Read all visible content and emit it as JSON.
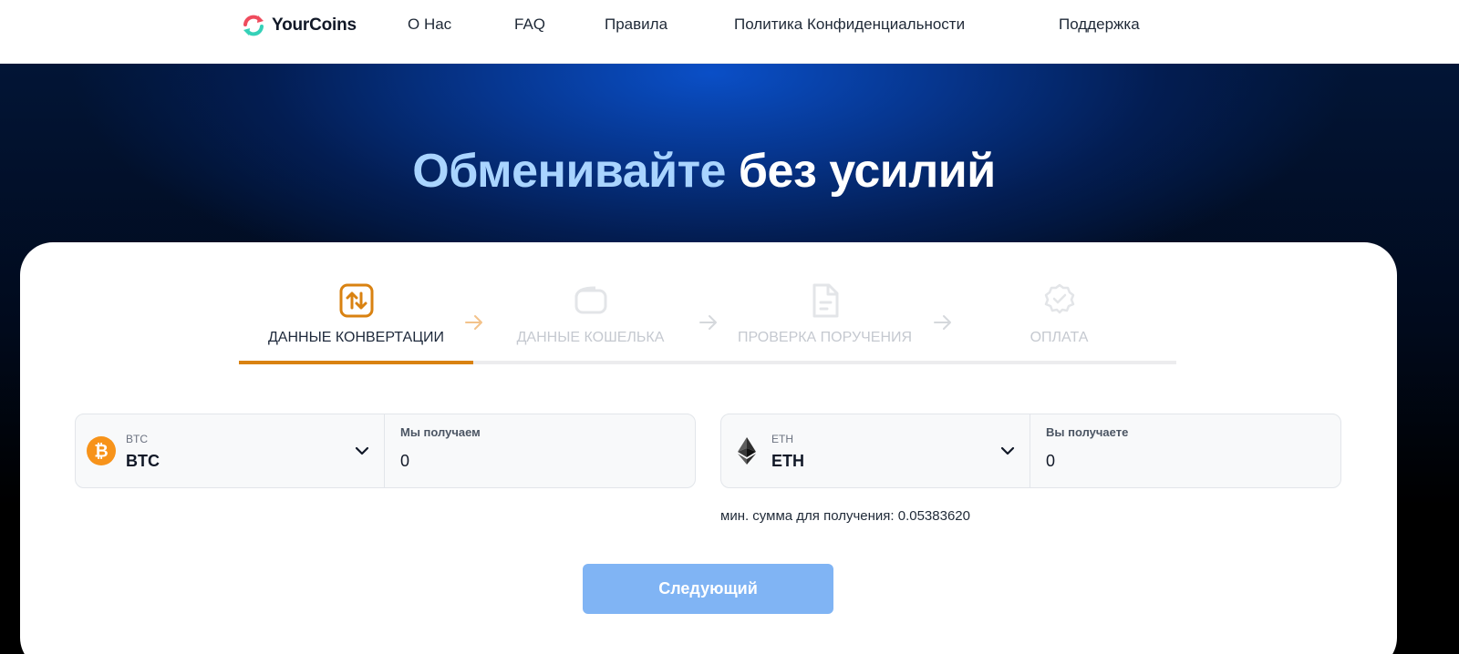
{
  "header": {
    "logo_text": "YourCoins",
    "nav": [
      "О Нас",
      "FAQ",
      "Правила",
      "Политика Конфиденциальности",
      "Поддержка"
    ]
  },
  "hero": {
    "title_part1": "Обменивайте",
    "title_part2": "без усилий"
  },
  "steps": [
    {
      "label": "ДАННЫЕ КОНВЕРТАЦИИ",
      "icon": "swap-arrows-icon",
      "active": true
    },
    {
      "label": "ДАННЫЕ КОШЕЛЬКА",
      "icon": "wallet-icon",
      "active": false
    },
    {
      "label": "ПРОВЕРКА ПОРУЧЕНИЯ",
      "icon": "document-icon",
      "active": false
    },
    {
      "label": "ОПЛАТА",
      "icon": "award-badge-icon",
      "active": false
    }
  ],
  "exchange": {
    "send": {
      "currency_small": "BTC",
      "currency": "BTC",
      "amount_label": "Мы получаем",
      "amount": "0"
    },
    "receive": {
      "currency_small": "ETH",
      "currency": "ETH",
      "amount_label": "Вы получаете",
      "amount": "0"
    },
    "min_note": "мин. сумма для получения: 0.05383620"
  },
  "next_button": "Следующий",
  "colors": {
    "accent": "#d98211",
    "button": "#80b4f4",
    "hero_highlight": "#a9d4ff",
    "btc": "#f7931a"
  }
}
